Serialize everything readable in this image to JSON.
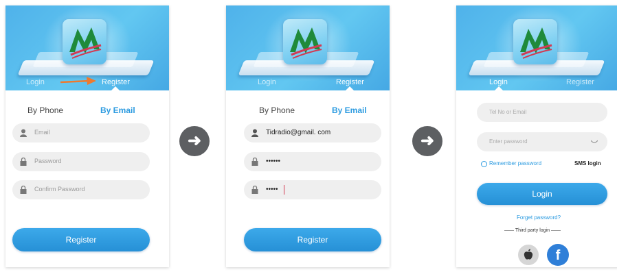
{
  "panels": [
    {
      "tabs": {
        "login": "Login",
        "register": "Register"
      },
      "subtabs": {
        "phone": "By Phone",
        "email": "By Email"
      },
      "fields": {
        "email": "Email",
        "password": "Password",
        "confirm": "Confirm Password"
      },
      "button": "Register"
    },
    {
      "tabs": {
        "login": "Login",
        "register": "Register"
      },
      "subtabs": {
        "phone": "By Phone",
        "email": "By Email"
      },
      "fields": {
        "email": "Tidradio@gmail. com",
        "password": "••••••",
        "confirm": "•••••"
      },
      "button": "Register"
    },
    {
      "tabs": {
        "login": "Login",
        "register": "Register"
      },
      "fields": {
        "account": "Tel No or Email",
        "password": "Enter password"
      },
      "remember": "Remember password",
      "sms": "SMS login",
      "button": "Login",
      "forgot": "Forget password?",
      "third_party": "—— Third party login ——"
    }
  ],
  "colors": {
    "accent": "#2c9be0",
    "hero": "#55b9ee",
    "arrow": "#ee7a2f"
  }
}
